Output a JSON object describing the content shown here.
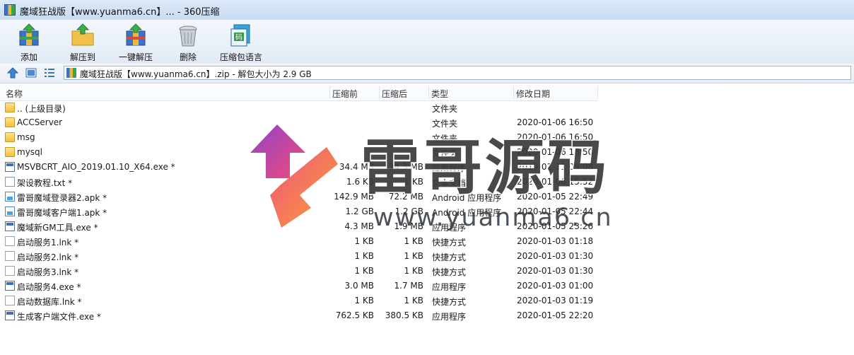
{
  "window": {
    "title": "魔域狂战版【www.yuanma6.cn】... - 360压缩"
  },
  "toolbar": {
    "buttons": [
      {
        "label": "添加",
        "icon": "add-archive-icon"
      },
      {
        "label": "解压到",
        "icon": "extract-to-icon"
      },
      {
        "label": "一键解压",
        "icon": "one-click-extract-icon"
      },
      {
        "label": "删除",
        "icon": "trash-icon"
      },
      {
        "label": "压缩包语言",
        "icon": "archive-language-icon"
      }
    ]
  },
  "address": {
    "path": "魔域狂战版【www.yuanma6.cn】.zip - 解包大小为 2.9 GB"
  },
  "columns": {
    "name": "名称",
    "packed": "压缩前",
    "size": "压缩后",
    "type": "类型",
    "modified": "修改日期"
  },
  "files": [
    {
      "name": ".. (上级目录)",
      "packed": "",
      "size": "",
      "type": "文件夹",
      "modified": "",
      "kind": "folder"
    },
    {
      "name": "ACCServer",
      "packed": "",
      "size": "",
      "type": "文件夹",
      "modified": "2020-01-06 16:50",
      "kind": "folder"
    },
    {
      "name": "msg",
      "packed": "",
      "size": "",
      "type": "文件夹",
      "modified": "2020-01-06 16:50",
      "kind": "folder"
    },
    {
      "name": "mysql",
      "packed": "",
      "size": "",
      "type": "文件夹",
      "modified": "2020-01-06 16:50",
      "kind": "folder"
    },
    {
      "name": "MSVBCRT_AIO_2019.01.10_X64.exe *",
      "packed": "34.4 MB",
      "size": "34.3 MB",
      "type": "应用程序",
      "modified": "2019-01-11 09:08",
      "kind": "exe"
    },
    {
      "name": "架设教程.txt *",
      "packed": "1.6 KB",
      "size": "1 KB",
      "type": "文本文档",
      "modified": "2020-01-06 15:52",
      "kind": "txt"
    },
    {
      "name": "雷哥魔域登录器2.apk *",
      "packed": "142.9 MB",
      "size": "72.2 MB",
      "type": "Android 应用程序",
      "modified": "2020-01-05 22:49",
      "kind": "apk"
    },
    {
      "name": "雷哥魔域客户端1.apk *",
      "packed": "1.2 GB",
      "size": "1.2 GB",
      "type": "Android 应用程序",
      "modified": "2020-01-05 22:44",
      "kind": "apk"
    },
    {
      "name": "魔域新GM工具.exe *",
      "packed": "4.3 MB",
      "size": "1.9 MB",
      "type": "应用程序",
      "modified": "2020-01-05 23:26",
      "kind": "exe"
    },
    {
      "name": "启动服务1.lnk *",
      "packed": "1 KB",
      "size": "1 KB",
      "type": "快捷方式",
      "modified": "2020-01-03 01:18",
      "kind": "lnk"
    },
    {
      "name": "启动服务2.lnk *",
      "packed": "1 KB",
      "size": "1 KB",
      "type": "快捷方式",
      "modified": "2020-01-03 01:30",
      "kind": "lnk"
    },
    {
      "name": "启动服务3.lnk *",
      "packed": "1 KB",
      "size": "1 KB",
      "type": "快捷方式",
      "modified": "2020-01-03 01:30",
      "kind": "lnk"
    },
    {
      "name": "启动服务4.exe *",
      "packed": "3.0 MB",
      "size": "1.7 MB",
      "type": "应用程序",
      "modified": "2020-01-03 01:00",
      "kind": "exe"
    },
    {
      "name": "启动数据库.lnk *",
      "packed": "1 KB",
      "size": "1 KB",
      "type": "快捷方式",
      "modified": "2020-01-03 01:19",
      "kind": "lnk"
    },
    {
      "name": "生成客户端文件.exe *",
      "packed": "762.5 KB",
      "size": "380.5 KB",
      "type": "应用程序",
      "modified": "2020-01-05 22:20",
      "kind": "exe"
    }
  ],
  "watermark": {
    "brand": "雷哥源码",
    "url": "www.yuanma6.cn"
  }
}
